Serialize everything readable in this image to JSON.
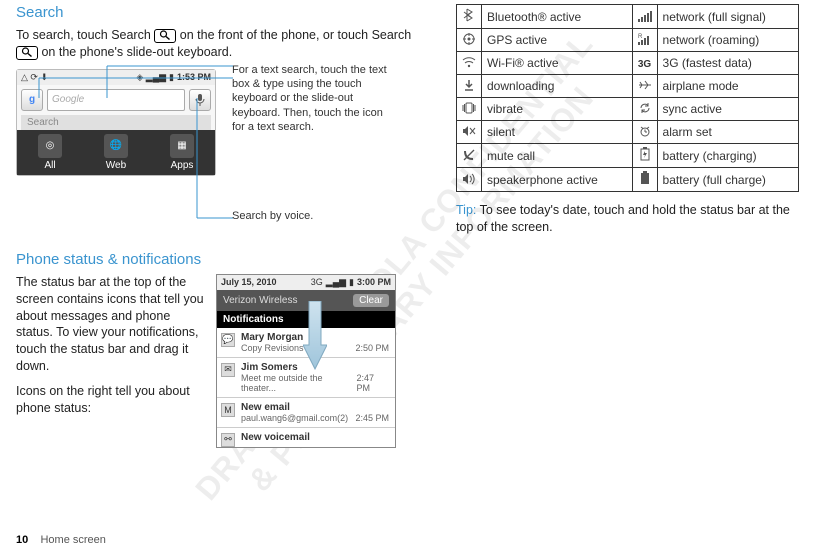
{
  "left": {
    "search_heading": "Search",
    "search_para_before": "To search, touch Search ",
    "search_para_mid": " on the front of the phone, or touch Search ",
    "search_para_after": " on the phone's slide-out keyboard.",
    "caption_text": "For a text search, touch the text box & type using the touch keyboard or the slide-out keyboard. Then, touch the icon for a text search.",
    "caption_voice": "Search by voice.",
    "shot1": {
      "time": "1:53 PM",
      "placeholder": "Google",
      "search_label": "Search",
      "tab_all": "All",
      "tab_web": "Web",
      "tab_apps": "Apps"
    },
    "ps_heading": "Phone status & notifications",
    "ps_para1": "The status bar at the top of the screen contains icons that tell you about messages and phone status. To view your notifications, touch the status bar and drag it down.",
    "ps_para2": "Icons on the right tell you about phone status:",
    "shot2": {
      "date": "July 15, 2010",
      "net": "3G",
      "time": "3:00 PM",
      "carrier": "Verizon Wireless",
      "clear": "Clear",
      "hdr": "Notifications",
      "n1_title": "Mary Morgan",
      "n1_sub": "Copy Revisions",
      "n1_time": "2:50 PM",
      "n2_title": "Jim Somers",
      "n2_sub": "Meet me outside the theater...",
      "n2_time": "2:47 PM",
      "n3_title": "New email",
      "n3_sub": "paul.wang6@gmail.com(2)",
      "n3_time": "2:45 PM",
      "n4_title": "New voicemail"
    }
  },
  "right": {
    "rows": {
      "r1a": "Bluetooth® active",
      "r1b": "network (full signal)",
      "r2a": "GPS active",
      "r2b": "network (roaming)",
      "r3a": "Wi-Fi® active",
      "r3b_icon": "3G",
      "r3b": "3G (fastest data)",
      "r4a": "downloading",
      "r4b": "airplane mode",
      "r5a": "vibrate",
      "r5b": "sync active",
      "r6a": "silent",
      "r6b": "alarm set",
      "r7a": "mute call",
      "r7b": "battery (charging)",
      "r8a": "speakerphone active",
      "r8b": "battery (full charge)"
    },
    "tip_label": "Tip: ",
    "tip_text": "To see today's date, touch and hold the status bar at the top of the screen."
  },
  "footer": {
    "page": "10",
    "section": "Home screen"
  }
}
